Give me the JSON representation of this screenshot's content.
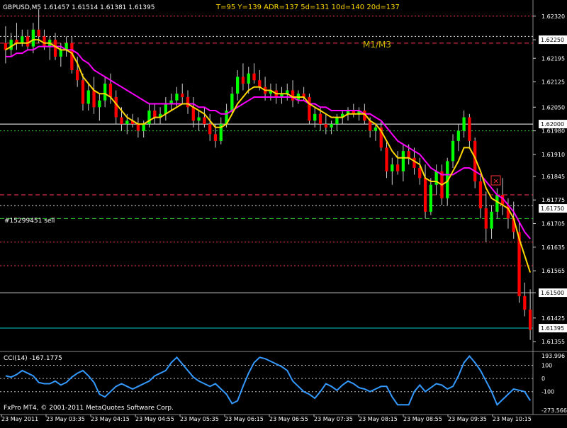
{
  "header": {
    "symbol_line": "GBPUSD,M5  1.61457 1.61514 1.61381 1.61395",
    "stats_line": "T=95   Y=139  ADR=137  5d=131  10d=140  20d=137"
  },
  "annotations": {
    "timeframe_text": "M1/M3",
    "order_label": "#15299451 sell"
  },
  "footer": {
    "copyright": "FxPro MT4, © 2001-2011 MetaQuotes Software Corp."
  },
  "colors": {
    "background": "#000000",
    "bull_candle": "#00ff00",
    "bear_candle": "#ff0000",
    "fast_ma": "#ffd700",
    "slow_ma": "#ff00ff",
    "cci_line": "#3399ff",
    "axis_text": "#ffffff",
    "header_text": "#ffd700"
  },
  "chart_data": [
    {
      "type": "candlestick",
      "symbol": "GBPUSD",
      "timeframe": "M5",
      "ylim": [
        1.6133,
        1.6233
      ],
      "price_ticks": [
        "1.62320",
        "1.62250",
        "1.62195",
        "1.62125",
        "1.62050",
        "1.61980",
        "1.61910",
        "1.61845",
        "1.61775",
        "1.61705",
        "1.61635",
        "1.61565",
        "1.61500",
        "1.61425",
        "1.61355"
      ],
      "highlighted_prices": [
        {
          "label": "1.62250",
          "value": 1.6225
        },
        {
          "label": "1.62000",
          "value": 1.62
        },
        {
          "label": "1.61750",
          "value": 1.6175
        },
        {
          "label": "1.61500",
          "value": 1.615
        },
        {
          "label": "1.61395",
          "value": 1.61395
        }
      ],
      "time_labels": [
        "23 May 2011",
        "23 May 03:35",
        "23 May 04:15",
        "23 May 04:55",
        "23 May 05:35",
        "23 May 06:15",
        "23 May 06:55",
        "23 May 07:35",
        "23 May 08:15",
        "23 May 08:55",
        "23 May 09:35",
        "23 May 10:15"
      ],
      "horizontal_levels": [
        {
          "price": 1.6232,
          "color": "#ff3355",
          "style": "dotted"
        },
        {
          "price": 1.6226,
          "color": "#dddddd",
          "style": "dotted"
        },
        {
          "price": 1.6224,
          "color": "#ff3355",
          "style": "dashed"
        },
        {
          "price": 1.62,
          "color": "#ffffff",
          "style": "solid"
        },
        {
          "price": 1.6198,
          "color": "#33cc33",
          "style": "dotted"
        },
        {
          "price": 1.6179,
          "color": "#ff3355",
          "style": "dashed"
        },
        {
          "price": 1.61758,
          "color": "#dddddd",
          "style": "dotted"
        },
        {
          "price": 1.6172,
          "color": "#33cc33",
          "style": "dashed"
        },
        {
          "price": 1.6165,
          "color": "#ff3355",
          "style": "dotted"
        },
        {
          "price": 1.6158,
          "color": "#ff3355",
          "style": "dotted"
        },
        {
          "price": 1.615,
          "color": "#cccccc",
          "style": "solid"
        },
        {
          "price": 1.61395,
          "color": "#00cccc",
          "style": "solid"
        }
      ],
      "candles": [
        {
          "o": 1.6224,
          "h": 1.6229,
          "l": 1.6218,
          "c": 1.6222
        },
        {
          "o": 1.6222,
          "h": 1.6227,
          "l": 1.622,
          "c": 1.6225
        },
        {
          "o": 1.6225,
          "h": 1.623,
          "l": 1.6222,
          "c": 1.6224
        },
        {
          "o": 1.6224,
          "h": 1.6228,
          "l": 1.6223,
          "c": 1.6226
        },
        {
          "o": 1.6226,
          "h": 1.6228,
          "l": 1.6222,
          "c": 1.6223
        },
        {
          "o": 1.6223,
          "h": 1.623,
          "l": 1.6221,
          "c": 1.6228
        },
        {
          "o": 1.6228,
          "h": 1.6234,
          "l": 1.6224,
          "c": 1.6226
        },
        {
          "o": 1.6226,
          "h": 1.6228,
          "l": 1.6222,
          "c": 1.6223
        },
        {
          "o": 1.6223,
          "h": 1.6226,
          "l": 1.6219,
          "c": 1.6225
        },
        {
          "o": 1.6225,
          "h": 1.6227,
          "l": 1.6219,
          "c": 1.622
        },
        {
          "o": 1.622,
          "h": 1.6224,
          "l": 1.6217,
          "c": 1.6222
        },
        {
          "o": 1.6222,
          "h": 1.6226,
          "l": 1.622,
          "c": 1.6224
        },
        {
          "o": 1.6224,
          "h": 1.6226,
          "l": 1.6215,
          "c": 1.6216
        },
        {
          "o": 1.6216,
          "h": 1.622,
          "l": 1.6211,
          "c": 1.6213
        },
        {
          "o": 1.6213,
          "h": 1.6215,
          "l": 1.6204,
          "c": 1.6206
        },
        {
          "o": 1.6206,
          "h": 1.6212,
          "l": 1.6204,
          "c": 1.621
        },
        {
          "o": 1.621,
          "h": 1.6214,
          "l": 1.6203,
          "c": 1.6205
        },
        {
          "o": 1.6205,
          "h": 1.6209,
          "l": 1.6201,
          "c": 1.6207
        },
        {
          "o": 1.6207,
          "h": 1.6214,
          "l": 1.6205,
          "c": 1.6212
        },
        {
          "o": 1.6212,
          "h": 1.6215,
          "l": 1.6206,
          "c": 1.6208
        },
        {
          "o": 1.6208,
          "h": 1.621,
          "l": 1.62,
          "c": 1.6202
        },
        {
          "o": 1.6202,
          "h": 1.6205,
          "l": 1.6198,
          "c": 1.62
        },
        {
          "o": 1.62,
          "h": 1.6203,
          "l": 1.6197,
          "c": 1.6201
        },
        {
          "o": 1.6201,
          "h": 1.6203,
          "l": 1.6199,
          "c": 1.62
        },
        {
          "o": 1.62,
          "h": 1.6202,
          "l": 1.6196,
          "c": 1.6198
        },
        {
          "o": 1.6198,
          "h": 1.6201,
          "l": 1.6196,
          "c": 1.62
        },
        {
          "o": 1.62,
          "h": 1.6206,
          "l": 1.6199,
          "c": 1.6204
        },
        {
          "o": 1.6204,
          "h": 1.6206,
          "l": 1.62,
          "c": 1.6202
        },
        {
          "o": 1.6202,
          "h": 1.6205,
          "l": 1.62,
          "c": 1.6203
        },
        {
          "o": 1.6203,
          "h": 1.6208,
          "l": 1.6201,
          "c": 1.6206
        },
        {
          "o": 1.6206,
          "h": 1.6209,
          "l": 1.6204,
          "c": 1.6207
        },
        {
          "o": 1.6207,
          "h": 1.6211,
          "l": 1.6205,
          "c": 1.6209
        },
        {
          "o": 1.6209,
          "h": 1.6212,
          "l": 1.6206,
          "c": 1.6208
        },
        {
          "o": 1.6208,
          "h": 1.621,
          "l": 1.6203,
          "c": 1.6205
        },
        {
          "o": 1.6205,
          "h": 1.6208,
          "l": 1.6199,
          "c": 1.6201
        },
        {
          "o": 1.6201,
          "h": 1.6204,
          "l": 1.6198,
          "c": 1.6202
        },
        {
          "o": 1.6202,
          "h": 1.6205,
          "l": 1.6199,
          "c": 1.62
        },
        {
          "o": 1.62,
          "h": 1.6203,
          "l": 1.6195,
          "c": 1.6197
        },
        {
          "o": 1.6197,
          "h": 1.62,
          "l": 1.6193,
          "c": 1.6195
        },
        {
          "o": 1.6195,
          "h": 1.6202,
          "l": 1.6194,
          "c": 1.62
        },
        {
          "o": 1.62,
          "h": 1.6206,
          "l": 1.6199,
          "c": 1.6204
        },
        {
          "o": 1.6204,
          "h": 1.6211,
          "l": 1.6203,
          "c": 1.6209
        },
        {
          "o": 1.6209,
          "h": 1.6216,
          "l": 1.6207,
          "c": 1.6214
        },
        {
          "o": 1.6214,
          "h": 1.6218,
          "l": 1.621,
          "c": 1.6212
        },
        {
          "o": 1.6212,
          "h": 1.6217,
          "l": 1.6209,
          "c": 1.6215
        },
        {
          "o": 1.6215,
          "h": 1.6218,
          "l": 1.6212,
          "c": 1.6213
        },
        {
          "o": 1.6213,
          "h": 1.6216,
          "l": 1.621,
          "c": 1.6211
        },
        {
          "o": 1.6211,
          "h": 1.6214,
          "l": 1.6207,
          "c": 1.6209
        },
        {
          "o": 1.6209,
          "h": 1.6212,
          "l": 1.6207,
          "c": 1.621
        },
        {
          "o": 1.621,
          "h": 1.6212,
          "l": 1.6206,
          "c": 1.6208
        },
        {
          "o": 1.6208,
          "h": 1.6211,
          "l": 1.6206,
          "c": 1.6209
        },
        {
          "o": 1.6209,
          "h": 1.6212,
          "l": 1.6207,
          "c": 1.621
        },
        {
          "o": 1.621,
          "h": 1.6213,
          "l": 1.6205,
          "c": 1.6207
        },
        {
          "o": 1.6207,
          "h": 1.621,
          "l": 1.6206,
          "c": 1.6209
        },
        {
          "o": 1.6209,
          "h": 1.6211,
          "l": 1.6207,
          "c": 1.6208
        },
        {
          "o": 1.6208,
          "h": 1.6209,
          "l": 1.62,
          "c": 1.6201
        },
        {
          "o": 1.6201,
          "h": 1.6205,
          "l": 1.6199,
          "c": 1.6203
        },
        {
          "o": 1.6203,
          "h": 1.6205,
          "l": 1.6198,
          "c": 1.62
        },
        {
          "o": 1.62,
          "h": 1.6203,
          "l": 1.6197,
          "c": 1.6199
        },
        {
          "o": 1.6199,
          "h": 1.6201,
          "l": 1.6197,
          "c": 1.62
        },
        {
          "o": 1.62,
          "h": 1.6203,
          "l": 1.6198,
          "c": 1.6202
        },
        {
          "o": 1.6202,
          "h": 1.6204,
          "l": 1.62,
          "c": 1.6203
        },
        {
          "o": 1.6203,
          "h": 1.6205,
          "l": 1.6201,
          "c": 1.6204
        },
        {
          "o": 1.6204,
          "h": 1.6206,
          "l": 1.6202,
          "c": 1.6203
        },
        {
          "o": 1.6203,
          "h": 1.6205,
          "l": 1.6201,
          "c": 1.6204
        },
        {
          "o": 1.6204,
          "h": 1.6206,
          "l": 1.62,
          "c": 1.6201
        },
        {
          "o": 1.6201,
          "h": 1.6202,
          "l": 1.6196,
          "c": 1.6198
        },
        {
          "o": 1.6198,
          "h": 1.62,
          "l": 1.6195,
          "c": 1.6199
        },
        {
          "o": 1.6199,
          "h": 1.6201,
          "l": 1.6192,
          "c": 1.6193
        },
        {
          "o": 1.6193,
          "h": 1.6195,
          "l": 1.6184,
          "c": 1.6186
        },
        {
          "o": 1.6186,
          "h": 1.619,
          "l": 1.6182,
          "c": 1.6188
        },
        {
          "o": 1.6188,
          "h": 1.6192,
          "l": 1.6185,
          "c": 1.6186
        },
        {
          "o": 1.6186,
          "h": 1.6194,
          "l": 1.6183,
          "c": 1.6192
        },
        {
          "o": 1.6192,
          "h": 1.6194,
          "l": 1.6188,
          "c": 1.619
        },
        {
          "o": 1.619,
          "h": 1.6193,
          "l": 1.6185,
          "c": 1.6187
        },
        {
          "o": 1.6187,
          "h": 1.619,
          "l": 1.6182,
          "c": 1.6184
        },
        {
          "o": 1.6184,
          "h": 1.6188,
          "l": 1.6172,
          "c": 1.6174
        },
        {
          "o": 1.6174,
          "h": 1.6184,
          "l": 1.6173,
          "c": 1.6182
        },
        {
          "o": 1.6182,
          "h": 1.6188,
          "l": 1.6179,
          "c": 1.6186
        },
        {
          "o": 1.6186,
          "h": 1.6188,
          "l": 1.6176,
          "c": 1.6178
        },
        {
          "o": 1.6178,
          "h": 1.619,
          "l": 1.6176,
          "c": 1.6189
        },
        {
          "o": 1.6189,
          "h": 1.6197,
          "l": 1.6187,
          "c": 1.6195
        },
        {
          "o": 1.6195,
          "h": 1.62,
          "l": 1.6192,
          "c": 1.6198
        },
        {
          "o": 1.6198,
          "h": 1.6204,
          "l": 1.6196,
          "c": 1.6202
        },
        {
          "o": 1.6202,
          "h": 1.6203,
          "l": 1.6193,
          "c": 1.6195
        },
        {
          "o": 1.6195,
          "h": 1.6196,
          "l": 1.6181,
          "c": 1.6183
        },
        {
          "o": 1.6183,
          "h": 1.6185,
          "l": 1.6172,
          "c": 1.6175
        },
        {
          "o": 1.6175,
          "h": 1.618,
          "l": 1.6165,
          "c": 1.6169
        },
        {
          "o": 1.6169,
          "h": 1.6176,
          "l": 1.6166,
          "c": 1.6174
        },
        {
          "o": 1.6174,
          "h": 1.6181,
          "l": 1.6172,
          "c": 1.6179
        },
        {
          "o": 1.6179,
          "h": 1.6184,
          "l": 1.6173,
          "c": 1.6176
        },
        {
          "o": 1.6176,
          "h": 1.6178,
          "l": 1.6169,
          "c": 1.6172
        },
        {
          "o": 1.6172,
          "h": 1.6177,
          "l": 1.6166,
          "c": 1.6168
        },
        {
          "o": 1.6168,
          "h": 1.6171,
          "l": 1.6147,
          "c": 1.6149
        },
        {
          "o": 1.6149,
          "h": 1.6153,
          "l": 1.6143,
          "c": 1.6145
        },
        {
          "o": 1.6145,
          "h": 1.6151,
          "l": 1.6136,
          "c": 1.6139
        }
      ],
      "fast_ma": [
        1.6222,
        1.6223,
        1.6224,
        1.6224,
        1.6224,
        1.6225,
        1.6225,
        1.6224,
        1.6224,
        1.6223,
        1.6222,
        1.6222,
        1.6221,
        1.6218,
        1.6214,
        1.6212,
        1.621,
        1.6209,
        1.6209,
        1.6208,
        1.6206,
        1.6204,
        1.6202,
        1.6201,
        1.62,
        1.62,
        1.6201,
        1.6202,
        1.6202,
        1.6203,
        1.6204,
        1.6205,
        1.6206,
        1.6206,
        1.6205,
        1.6204,
        1.6203,
        1.6201,
        1.6199,
        1.6199,
        1.62,
        1.6203,
        1.6206,
        1.6208,
        1.621,
        1.6211,
        1.6211,
        1.621,
        1.621,
        1.6209,
        1.6209,
        1.6209,
        1.6208,
        1.6208,
        1.6208,
        1.6206,
        1.6205,
        1.6204,
        1.6203,
        1.6202,
        1.6202,
        1.6202,
        1.6203,
        1.6203,
        1.6203,
        1.6203,
        1.6201,
        1.62,
        1.6198,
        1.6195,
        1.6192,
        1.619,
        1.619,
        1.619,
        1.6189,
        1.6188,
        1.6184,
        1.6183,
        1.6183,
        1.6182,
        1.6183,
        1.6186,
        1.6189,
        1.6193,
        1.6193,
        1.619,
        1.6186,
        1.6181,
        1.6178,
        1.6177,
        1.6176,
        1.6175,
        1.6172,
        1.6166,
        1.6161,
        1.6156
      ],
      "slow_ma": [
        1.622,
        1.622,
        1.6221,
        1.6221,
        1.6222,
        1.6222,
        1.6223,
        1.6223,
        1.6223,
        1.6223,
        1.6223,
        1.6222,
        1.6222,
        1.6221,
        1.6219,
        1.6218,
        1.6216,
        1.6215,
        1.6214,
        1.6213,
        1.6212,
        1.6211,
        1.621,
        1.6209,
        1.6208,
        1.6207,
        1.6206,
        1.6206,
        1.6206,
        1.6206,
        1.6206,
        1.6206,
        1.6206,
        1.6206,
        1.6206,
        1.6205,
        1.6205,
        1.6204,
        1.6204,
        1.6203,
        1.6203,
        1.6204,
        1.6205,
        1.6206,
        1.6207,
        1.6208,
        1.6208,
        1.6208,
        1.6208,
        1.6208,
        1.6208,
        1.6208,
        1.6208,
        1.6207,
        1.6207,
        1.6206,
        1.6206,
        1.6205,
        1.6205,
        1.6204,
        1.6204,
        1.6204,
        1.6204,
        1.6204,
        1.6204,
        1.6203,
        1.6203,
        1.6202,
        1.6201,
        1.6199,
        1.6197,
        1.6195,
        1.6194,
        1.6193,
        1.6192,
        1.6191,
        1.6189,
        1.6187,
        1.6186,
        1.6185,
        1.6185,
        1.6185,
        1.6186,
        1.6187,
        1.6187,
        1.6186,
        1.6185,
        1.6183,
        1.6181,
        1.6179,
        1.6178,
        1.6176,
        1.6174,
        1.6171,
        1.6168,
        1.6166
      ]
    },
    {
      "type": "line",
      "indicator": "CCI",
      "name": "CCI(14) -167.1775",
      "ylim": [
        -273.566,
        193.996
      ],
      "y_tick_labels": [
        "193.996",
        "100",
        "0",
        "-100",
        "-273.566"
      ],
      "levels": [
        100,
        0,
        -100
      ],
      "values": [
        20,
        10,
        30,
        60,
        40,
        20,
        -30,
        -40,
        -40,
        -20,
        -50,
        -30,
        10,
        40,
        60,
        20,
        -30,
        -120,
        -140,
        -100,
        -60,
        -40,
        -60,
        -80,
        -60,
        -40,
        -20,
        20,
        40,
        60,
        120,
        160,
        110,
        60,
        10,
        -20,
        -40,
        -60,
        -40,
        -80,
        -120,
        -190,
        -170,
        -60,
        40,
        120,
        160,
        150,
        130,
        110,
        90,
        60,
        -20,
        -60,
        -100,
        -120,
        -150,
        -100,
        -40,
        -60,
        -90,
        -50,
        -20,
        -40,
        -70,
        -80,
        -100,
        -80,
        -60,
        -60,
        -140,
        -200,
        -200,
        -200,
        -100,
        -50,
        -100,
        -70,
        -40,
        -50,
        -80,
        -60,
        20,
        120,
        170,
        120,
        60,
        -20,
        -100,
        -200,
        -160,
        -120,
        -80,
        -90,
        -100,
        -167
      ]
    }
  ]
}
